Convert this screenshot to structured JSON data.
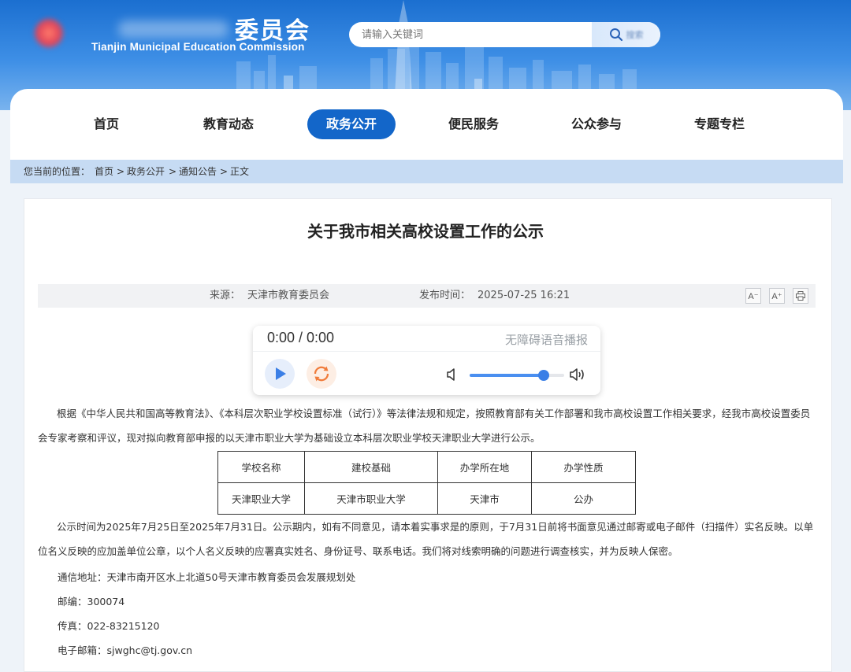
{
  "header": {
    "title_cn_visible": "委员会",
    "title_en": "Tianjin Municipal Education Commission",
    "search": {
      "placeholder": "请输入关键词",
      "button_label": "搜索"
    }
  },
  "nav": {
    "items": [
      {
        "label": "首页",
        "active": false
      },
      {
        "label": "教育动态",
        "active": false
      },
      {
        "label": "政务公开",
        "active": true
      },
      {
        "label": "便民服务",
        "active": false
      },
      {
        "label": "公众参与",
        "active": false
      },
      {
        "label": "专题专栏",
        "active": false
      }
    ]
  },
  "breadcrumb": {
    "prefix": "您当前的位置：",
    "items": [
      "首页",
      "政务公开",
      "通知公告",
      "正文"
    ],
    "separator": ">"
  },
  "article": {
    "title": "关于我市相关高校设置工作的公示",
    "source_label": "来源：",
    "source": "天津市教育委员会",
    "date_label": "发布时间：",
    "date": "2025-07-25 16:21",
    "tools": {
      "font_smaller": "A⁻",
      "font_larger": "A⁺",
      "print_icon": "printer-icon"
    }
  },
  "player": {
    "time": "0:00 / 0:00",
    "label": "无障碍语音播报",
    "volume_level": 0.78
  },
  "body": {
    "para1": "根据《中华人民共和国高等教育法》、《本科层次职业学校设置标准（试行）》等法律法规和规定，按照教育部有关工作部署和我市高校设置工作相关要求，经我市高校设置委员会专家考察和评议，现对拟向教育部申报的以天津市职业大学为基础设立本科层次职业学校天津职业大学进行公示。",
    "table": {
      "headers": [
        "学校名称",
        "建校基础",
        "办学所在地",
        "办学性质"
      ],
      "rows": [
        [
          "天津职业大学",
          "天津市职业大学",
          "天津市",
          "公办"
        ]
      ]
    },
    "para2": "公示时间为2025年7月25日至2025年7月31日。公示期内，如有不同意见，请本着实事求是的原则，于7月31日前将书面意见通过邮寄或电子邮件（扫描件）实名反映。以单位名义反映的应加盖单位公章，以个人名义反映的应署真实姓名、身份证号、联系电话。我们将对线索明确的问题进行调查核实，并为反映人保密。",
    "address": "通信地址：天津市南开区水上北道50号天津市教育委员会发展规划处",
    "postcode": "邮编：300074",
    "fax": "传真：022-83215120",
    "email": "电子邮箱：sjwghc@tj.gov.cn"
  },
  "colors": {
    "header_top": "#1b6fd0",
    "nav_active": "#1366c9",
    "breadcrumb_bg": "#c6dbf3",
    "volume_accent": "#3b7fe6",
    "replay_accent": "#f07b3a"
  }
}
